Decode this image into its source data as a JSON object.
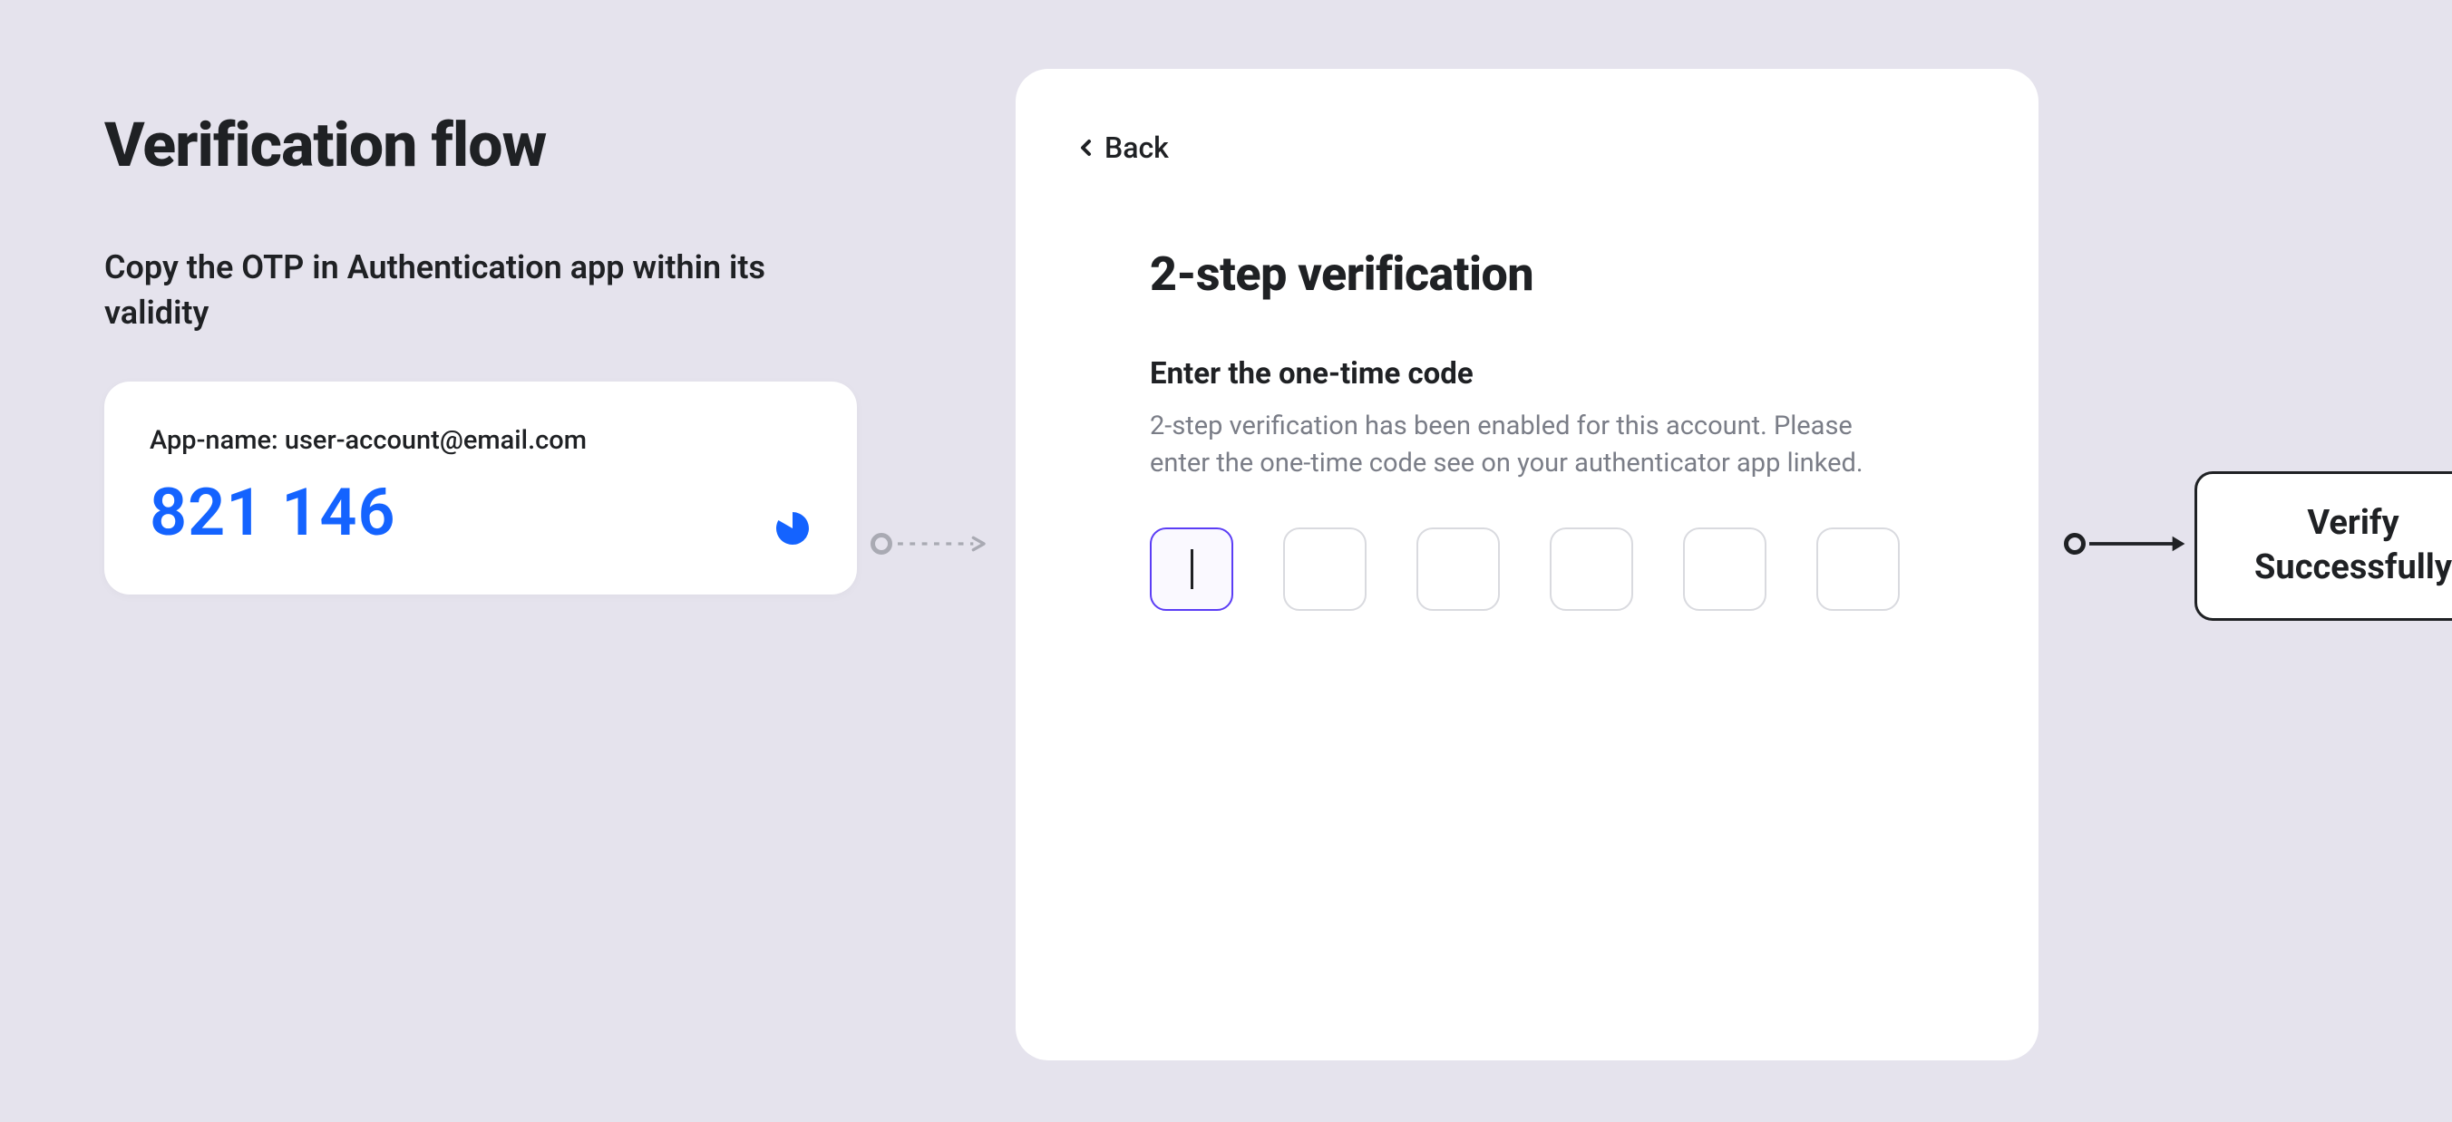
{
  "page": {
    "title": "Verification flow",
    "instruction": "Copy the OTP in Authentication app within its validity"
  },
  "otp_app": {
    "account_label": "App-name: user-account@email.com",
    "code": "821 146",
    "timer_icon": "pie-timer-icon"
  },
  "verification_card": {
    "back_label": "Back",
    "title": "2-step verification",
    "enter_label": "Enter the one-time code",
    "description": "2-step verification has been enabled for this account. Please enter the one-time code see on your authenticator app linked.",
    "num_inputs": 6,
    "active_input_index": 0
  },
  "result": {
    "line1": "Verify",
    "line2": "Successfully"
  },
  "colors": {
    "background": "#e5e3ed",
    "text_primary": "#1f2124",
    "text_secondary": "#7a7d87",
    "accent_blue": "#1463ff",
    "input_active_border": "#5b3df5",
    "input_border": "#d9dadf",
    "arrow_dashed": "#a9aab3"
  }
}
